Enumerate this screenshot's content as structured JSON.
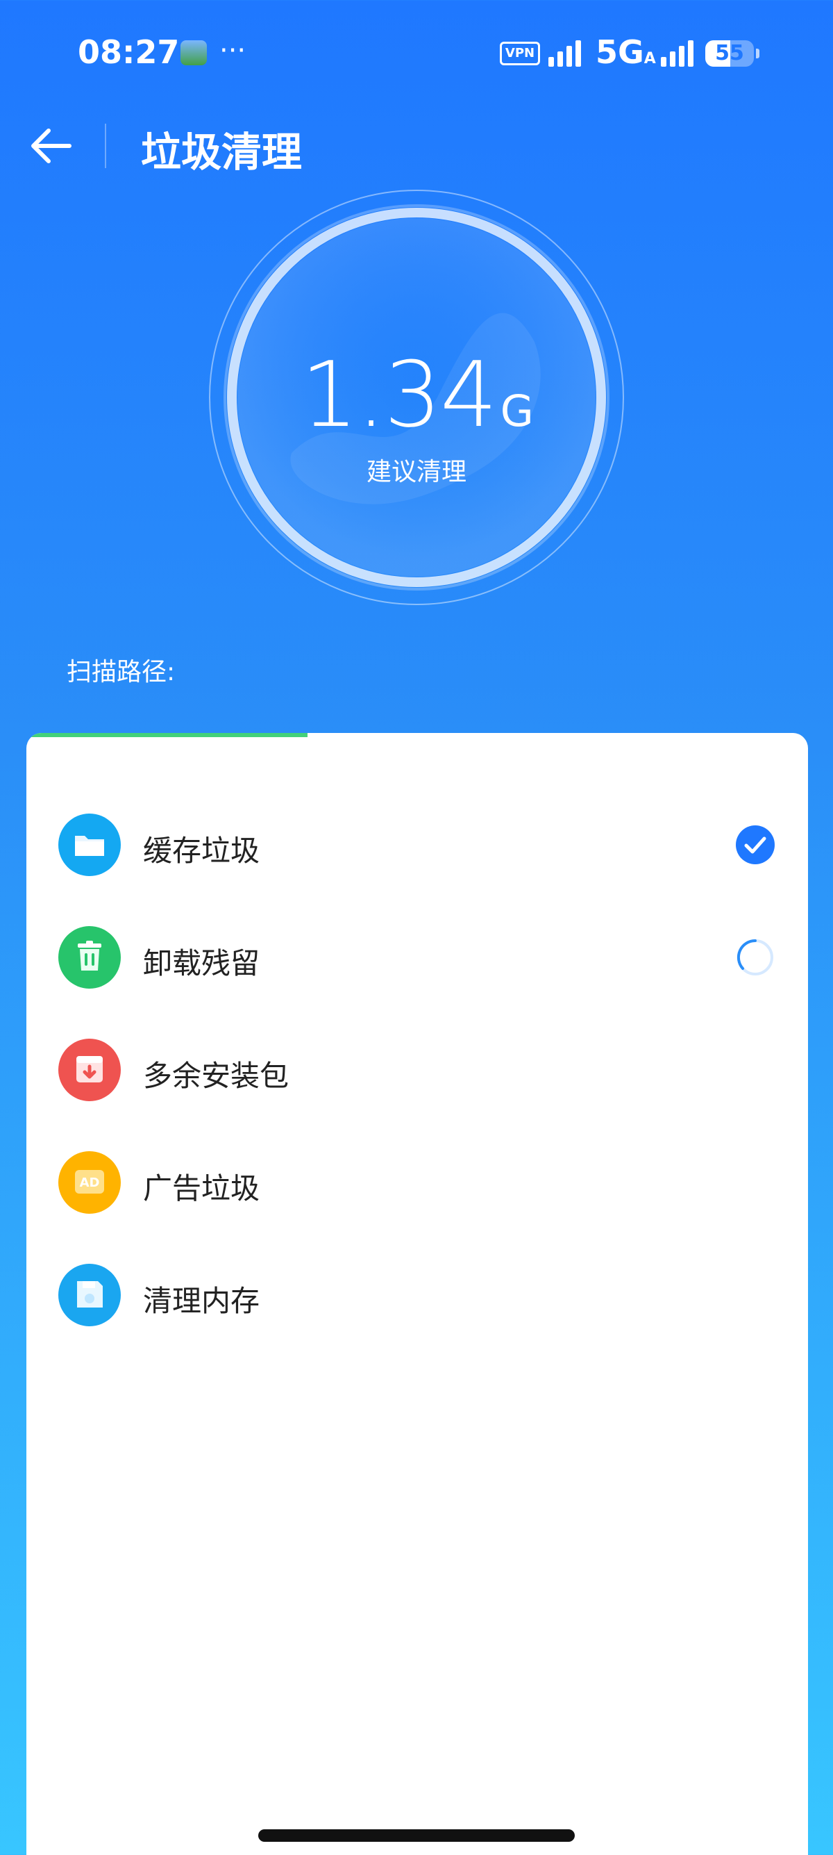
{
  "status_bar": {
    "time": "08:27",
    "more": "···",
    "vpn": "VPN",
    "network": "5G",
    "network_sub": "A",
    "battery": "55"
  },
  "header": {
    "title": "垃圾清理"
  },
  "summary": {
    "value": "1.34",
    "unit": "G",
    "hint": "建议清理"
  },
  "scan": {
    "label": "扫描路径:",
    "progress": 0.36
  },
  "items": [
    {
      "label": "缓存垃圾",
      "icon": "folder-icon",
      "color": "#14a8f2",
      "status": "done"
    },
    {
      "label": "卸载残留",
      "icon": "trash-icon",
      "color": "#27c46b",
      "status": "scanning"
    },
    {
      "label": "多余安装包",
      "icon": "package-icon",
      "color": "#ef5350",
      "status": "pending"
    },
    {
      "label": "广告垃圾",
      "icon": "ad-icon",
      "color": "#ffb300",
      "status": "pending"
    },
    {
      "label": "清理内存",
      "icon": "memory-icon",
      "color": "#1aa6f0",
      "status": "pending"
    }
  ],
  "colors": {
    "accent": "#1f78ff",
    "progress": "#43d17b"
  }
}
